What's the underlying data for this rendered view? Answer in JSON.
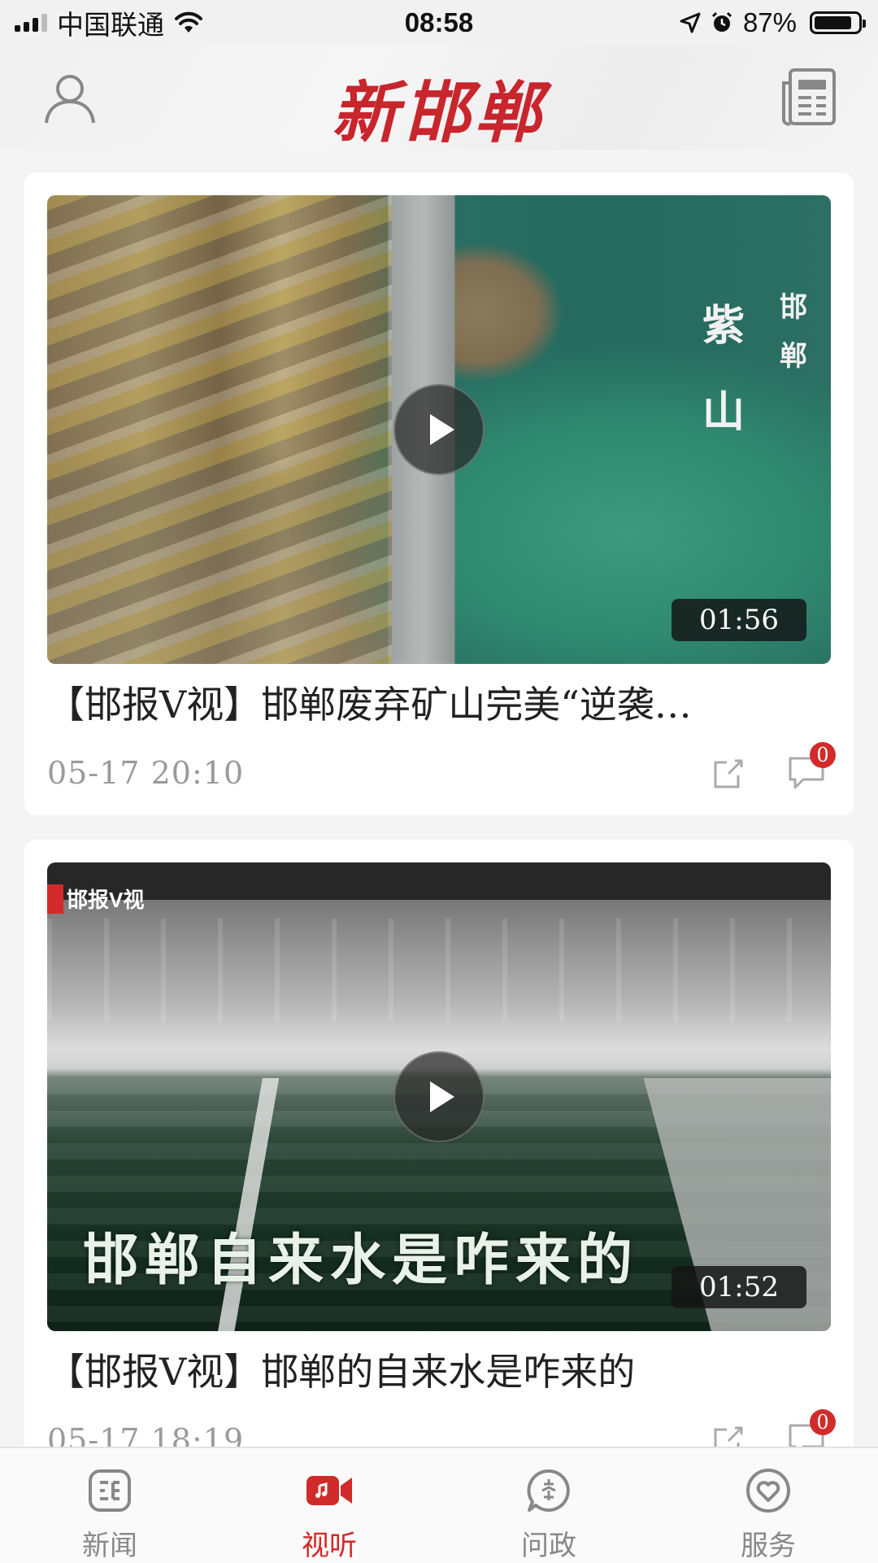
{
  "status_bar": {
    "carrier": "中国联通",
    "time": "08:58",
    "battery_pct": "87%",
    "battery_level": 0.87
  },
  "header": {
    "logo": "新邯郸",
    "profile_icon": "user-icon",
    "newspaper_icon": "newspaper-icon"
  },
  "feed": {
    "items": [
      {
        "title": "【邯报V视】邯郸废弃矿山完美“逆袭…",
        "timestamp": "05-17  20:10",
        "duration": "01:56",
        "comments": "0",
        "overlay_main": [
          "紫",
          "山"
        ],
        "overlay_small": [
          "邯",
          "郸"
        ]
      },
      {
        "title": "【邯报V视】邯郸的自来水是咋来的",
        "timestamp": "05-17  18:19",
        "duration": "01:52",
        "comments": "0",
        "brand_tag": "邯报V视",
        "caption": "邯郸自来水是咋来的"
      }
    ]
  },
  "tab_bar": {
    "tabs": [
      {
        "label": "新闻",
        "icon": "news-icon",
        "active": false
      },
      {
        "label": "视听",
        "icon": "video-icon",
        "active": true
      },
      {
        "label": "问政",
        "icon": "inquiry-icon",
        "active": false
      },
      {
        "label": "服务",
        "icon": "heart-service-icon",
        "active": false
      }
    ]
  },
  "colors": {
    "brand_red": "#c8252c",
    "active_tab": "#d02a2a",
    "inactive_tab": "#888888",
    "badge": "#d22b2b"
  }
}
